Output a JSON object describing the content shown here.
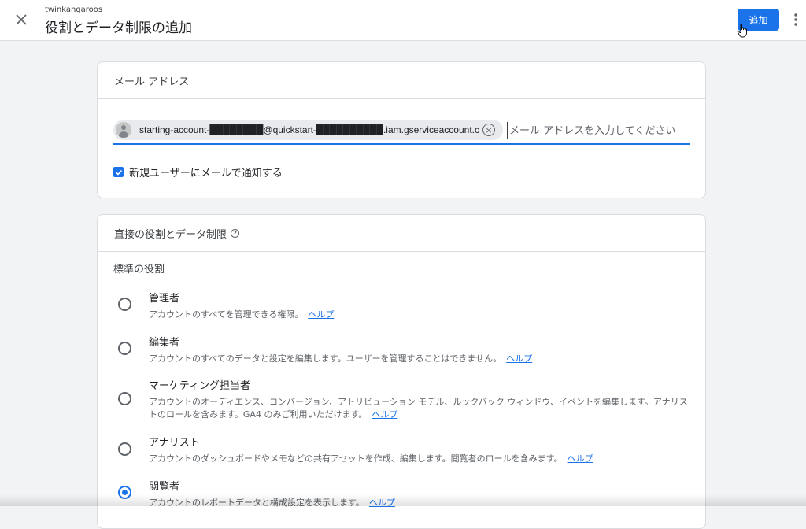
{
  "header": {
    "account_name": "twinkangaroos",
    "title": "役割とデータ制限の追加",
    "add_label": "追加"
  },
  "email_section": {
    "title": "メール アドレス",
    "chip_email": "starting-account-████████@quickstart-██████████.iam.gserviceaccount.com",
    "input_placeholder": "メール アドレスを入力してください",
    "notify_label": "新規ユーザーにメールで通知する",
    "notify_checked": true
  },
  "roles_section": {
    "title": "直接の役割とデータ制限",
    "standard_roles_label": "標準の役割",
    "help_link_label": "ヘルプ",
    "selected": "閲覧者",
    "roles": [
      {
        "name": "管理者",
        "description": "アカウントのすべてを管理できる権限。"
      },
      {
        "name": "編集者",
        "description": "アカウントのすべてのデータと設定を編集します。ユーザーを管理することはできません。"
      },
      {
        "name": "マーケティング担当者",
        "description": "アカウントのオーディエンス、コンバージョン、アトリビューション モデル、ルックバック ウィンドウ、イベントを編集します。アナリストのロールを含みます。GA4 のみご利用いただけます。"
      },
      {
        "name": "アナリスト",
        "description": "アカウントのダッシュボードやメモなどの共有アセットを作成、編集します。閲覧者のロールを含みます。"
      },
      {
        "name": "閲覧者",
        "description": "アカウントのレポートデータと構成設定を表示します。"
      }
    ]
  },
  "colors": {
    "accent": "#1a73e8",
    "background": "#f1f3f4"
  }
}
